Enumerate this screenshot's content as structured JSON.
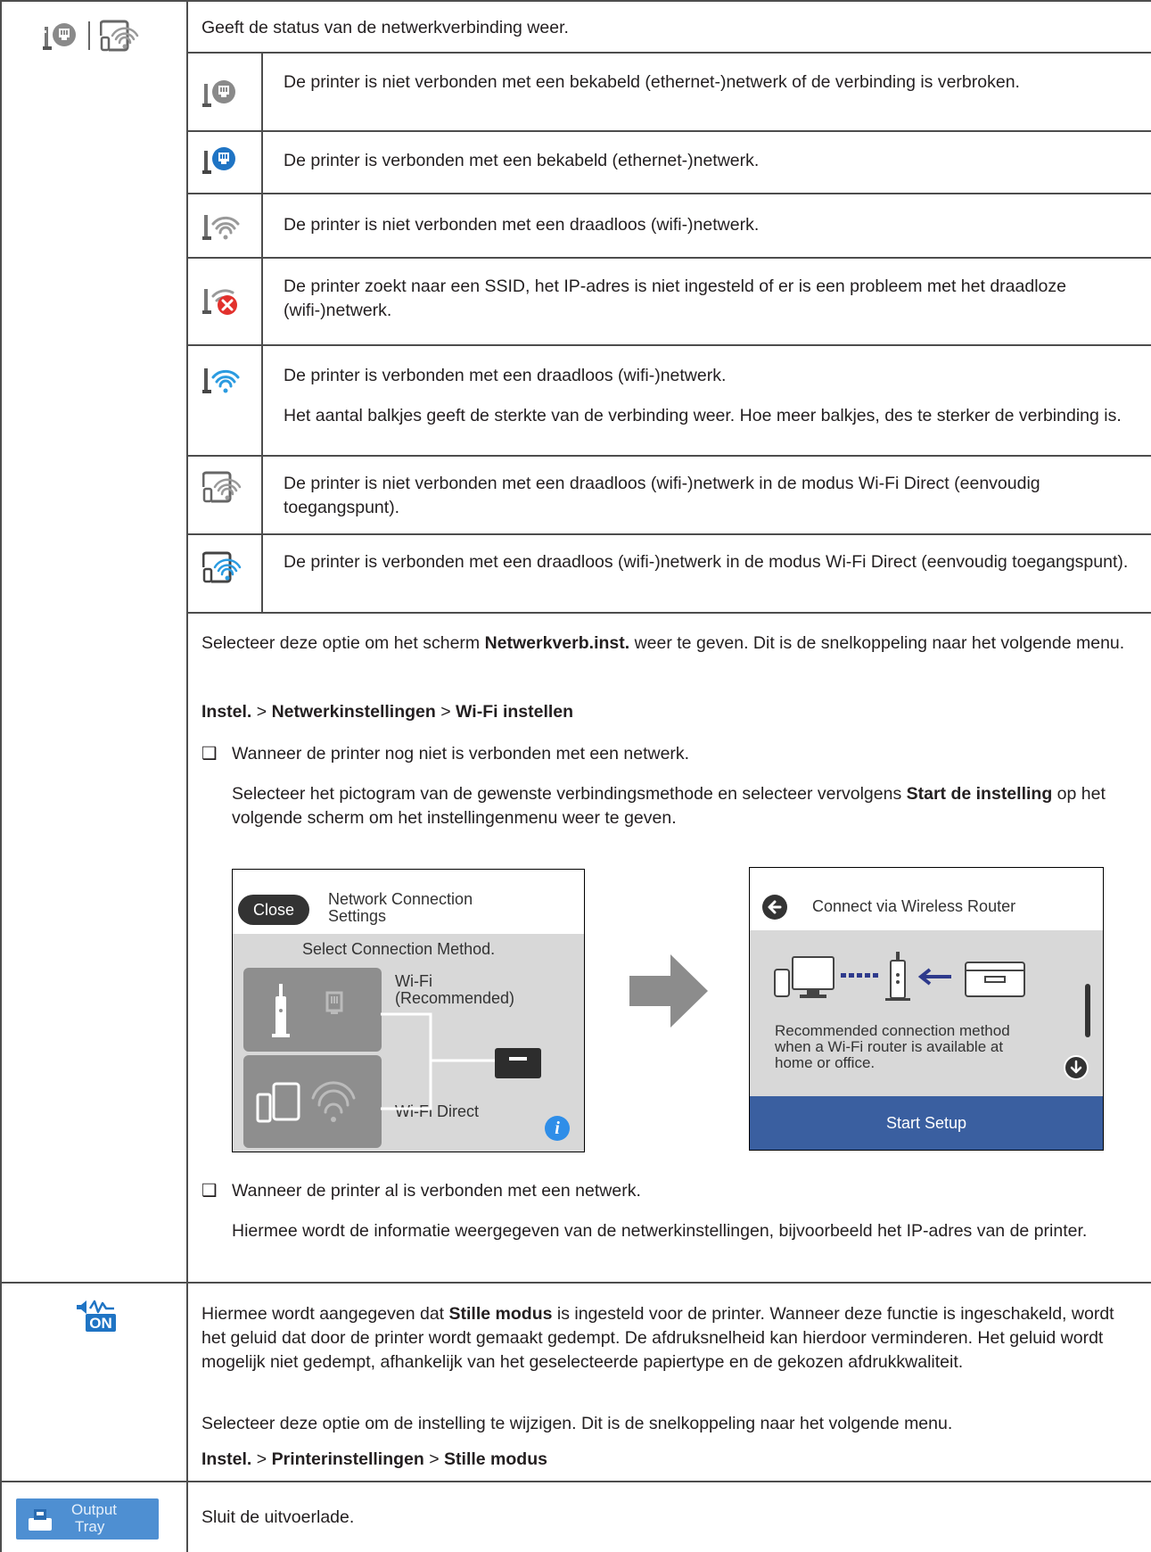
{
  "status_header": "Geeft de status van de netwerkverbinding weer.",
  "status_rows": [
    "De printer is niet verbonden met een bekabeld (ethernet-)netwerk of de verbinding is verbroken.",
    "De printer is verbonden met een bekabeld (ethernet-)netwerk.",
    "De printer is niet verbonden met een draadloos (wifi-)netwerk.",
    "De printer zoekt naar een SSID, het IP-adres is niet ingesteld of er is een probleem met het draadloze (wifi-)netwerk.",
    "De printer is verbonden met een draadloos (wifi-)netwerk.",
    "Het aantal balkjes geeft de sterkte van de verbinding weer. Hoe meer balkjes, des te sterker de verbinding is.",
    "De printer is niet verbonden met een draadloos (wifi-)netwerk in de modus Wi-Fi Direct (eenvoudig toegangspunt).",
    "De printer is verbonden met een draadloos (wifi-)netwerk in de modus Wi-Fi Direct (eenvoudig toegangspunt)."
  ],
  "network": {
    "intro_a": "Selecteer deze optie om het scherm ",
    "intro_bold": "Netwerkverb.inst.",
    "intro_b": " weer te geven. Dit is de snelkoppeling naar het volgende menu.",
    "path": [
      "Instel.",
      "Netwerkinstellingen",
      "Wi-Fi instellen"
    ],
    "path_sep": ">",
    "bullet": "❑",
    "case1": "Wanneer de printer nog niet is verbonden met een netwerk.",
    "case1_desc_a": "Selecteer het pictogram van de gewenste verbindingsmethode en selecteer vervolgens ",
    "case1_desc_bold": "Start de instelling",
    "case1_desc_b": " op het volgende scherm om het instellingenmenu weer te geven.",
    "case2": "Wanneer de printer al is verbonden met een netwerk.",
    "case2_desc": "Hiermee wordt de informatie weergegeven van de netwerkinstellingen, bijvoorbeeld het IP-adres van de printer."
  },
  "screen1": {
    "close": "Close",
    "title_line1": "Network Connection",
    "title_line2": "Settings",
    "subtitle": "Select Connection Method.",
    "wifi_line1": "Wi-Fi",
    "wifi_line2": "(Recommended)",
    "wifi_direct": "Wi-Fi Direct",
    "info": "i"
  },
  "screen2": {
    "title": "Connect via Wireless Router",
    "desc_line1": "Recommended connection method",
    "desc_line2": "when a Wi-Fi router is available at",
    "desc_line3": "home or office.",
    "button": "Start Setup"
  },
  "quiet": {
    "icon_label": "ON",
    "desc_a": "Hiermee wordt aangegeven dat ",
    "desc_bold": "Stille modus",
    "desc_b": " is ingesteld voor de printer. Wanneer deze functie is ingeschakeld, wordt het geluid dat door de printer wordt gemaakt gedempt. De afdruksnelheid kan hierdoor verminderen. Het geluid wordt mogelijk niet gedempt, afhankelijk van het geselecteerde papiertype en de gekozen afdrukkwaliteit.",
    "change": "Selecteer deze optie om de instelling te wijzigen. Dit is de snelkoppeling naar het volgende menu.",
    "path": [
      "Instel.",
      "Printerinstellingen",
      "Stille modus"
    ],
    "path_sep": ">"
  },
  "output": {
    "icon_line1": "Output",
    "icon_line2": "Tray",
    "desc": "Sluit de uitvoerlade."
  },
  "colors": {
    "accent_blue": "#1f74c4",
    "wifi_blue": "#2b9be0",
    "error_red": "#e2312d",
    "screen_blue": "#3a5fa0"
  }
}
